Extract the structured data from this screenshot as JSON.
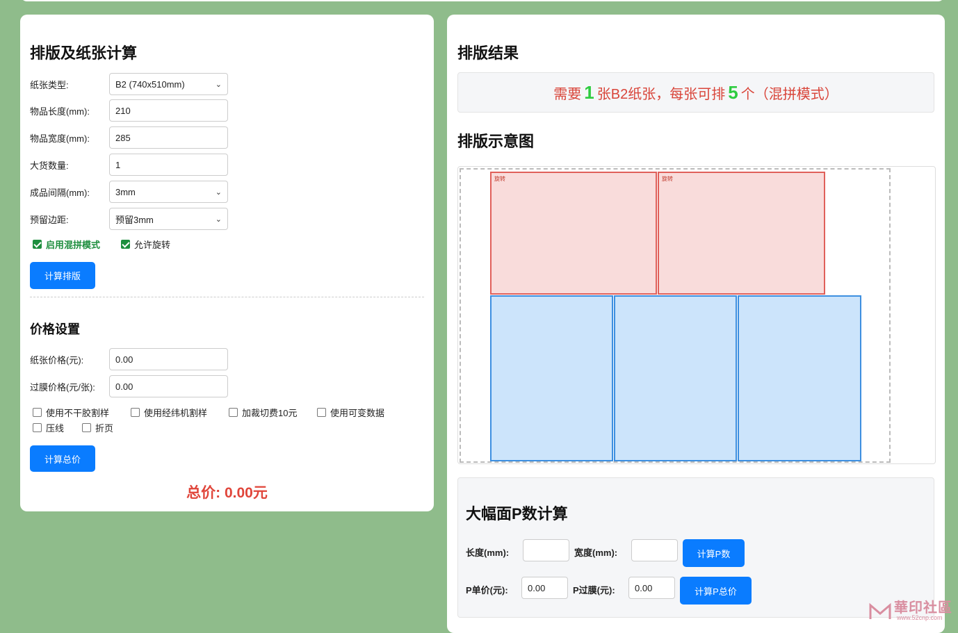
{
  "left": {
    "title": "排版及纸张计算",
    "fields": [
      {
        "label": "纸张类型:",
        "value": "B2 (740x510mm)",
        "type": "select"
      },
      {
        "label": "物品长度(mm):",
        "value": "210",
        "type": "input"
      },
      {
        "label": "物品宽度(mm):",
        "value": "285",
        "type": "input"
      },
      {
        "label": "大货数量:",
        "value": "1",
        "type": "input"
      },
      {
        "label": "成品间隔(mm):",
        "value": "3mm",
        "type": "select"
      },
      {
        "label": "预留边距:",
        "value": "预留3mm",
        "type": "select"
      }
    ],
    "mix_mode_label": "启用混拼模式",
    "rotate_label": "允许旋转",
    "calc_layout_button": "计算排版",
    "price_title": "价格设置",
    "paper_price_label": "纸张价格(元):",
    "paper_price_value": "0.00",
    "lam_price_label": "过膜价格(元/张):",
    "lam_price_value": "0.00",
    "options": [
      "使用不干胶割样",
      "使用经纬机割样",
      "加裁切费10元",
      "使用可变数据",
      "压线",
      "折页"
    ],
    "calc_total_button": "计算总价",
    "total_text": "总价: 0.00元"
  },
  "right": {
    "result_title": "排版结果",
    "result_prefix": "需要",
    "result_sheets": "1",
    "result_mid": "张B2纸张，每张可排",
    "result_count": "5",
    "result_suffix": "个（混拼模式）",
    "diagram_title": "排版示意图",
    "rotated_tag": "旋转",
    "pcalc": {
      "title": "大幅面P数计算",
      "length_label": "长度(mm):",
      "length_value": "",
      "width_label": "宽度(mm):",
      "width_value": "",
      "calc_p_button": "计算P数",
      "unit_price_label": "P单价(元):",
      "unit_price_value": "0.00",
      "lam_label": "P过膜(元):",
      "lam_value": "0.00",
      "calc_p_total_button": "计算P总价"
    }
  },
  "watermark": {
    "title": "華印社區",
    "url": "www.52cnp.com"
  },
  "colors": {
    "background": "#8fbc8b",
    "primary": "#0a7cff",
    "accent_red": "#e0453a",
    "accent_green": "#2ecc40"
  }
}
